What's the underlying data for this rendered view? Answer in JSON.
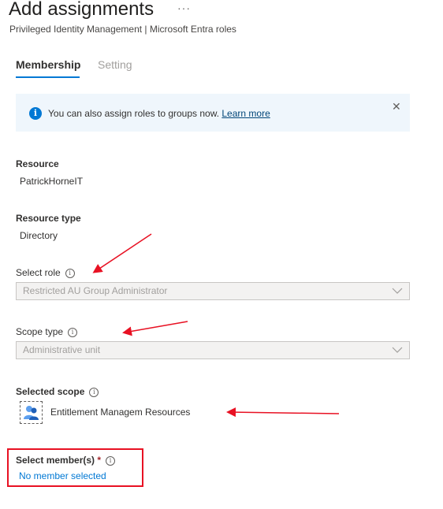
{
  "header": {
    "title": "Add assignments",
    "more_label": "···",
    "subtitle": "Privileged Identity Management | Microsoft Entra roles"
  },
  "tabs": [
    {
      "label": "Membership",
      "active": true
    },
    {
      "label": "Setting",
      "active": false
    }
  ],
  "info_bar": {
    "text": "You can also assign roles to groups now.",
    "link": "Learn more",
    "icon": "info-icon",
    "close_icon": "close-icon"
  },
  "fields": {
    "resource": {
      "label": "Resource",
      "value": "PatrickHorneIT"
    },
    "resource_type": {
      "label": "Resource type",
      "value": "Directory"
    },
    "select_role": {
      "label": "Select role",
      "value": "Restricted AU Group Administrator",
      "disabled": true
    },
    "scope_type": {
      "label": "Scope type",
      "value": "Administrative unit",
      "disabled": true
    },
    "selected_scope": {
      "label": "Selected scope",
      "value": "Entitlement Managem Resources",
      "icon": "group-icon"
    },
    "select_members": {
      "label": "Select member(s)",
      "required_mark": "*",
      "link": "No member selected"
    }
  },
  "colors": {
    "accent": "#0078d4",
    "annotation_red": "#e81123",
    "info_background": "#eff6fc"
  }
}
